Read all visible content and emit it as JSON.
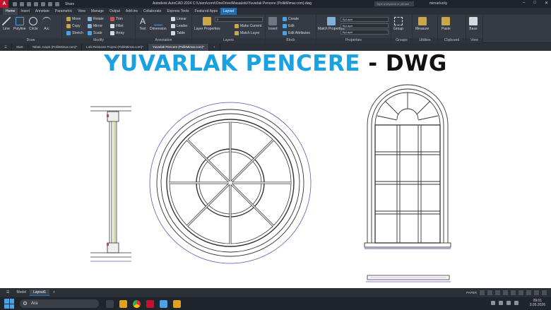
{
  "titlebar": {
    "title": "Autodesk AutoCAD 2024   C:\\Users\\corni\\OneDrive\\Masaüstü\\Yuvarlak Pencere (PolikMimar.com).dwg",
    "share": "Share",
    "search_placeholder": "Type a keyword or phrase",
    "user": "mimarlucity"
  },
  "ribbon_tabs": [
    "Home",
    "Insert",
    "Annotate",
    "Parametric",
    "View",
    "Manage",
    "Output",
    "Add-ins",
    "Collaborate",
    "Express Tools",
    "Featured Apps",
    "Layout"
  ],
  "ribbon": {
    "draw": {
      "title": "Draw",
      "tools": [
        "Line",
        "Polyline",
        "Circle",
        "Arc"
      ]
    },
    "modify": {
      "title": "Modify",
      "tools": [
        "Move",
        "Rotate",
        "Trim",
        "Copy",
        "Mirror",
        "Fillet",
        "Stretch",
        "Scale",
        "Array"
      ]
    },
    "annotation": {
      "title": "Annotation",
      "tools": [
        "Text",
        "Dimension",
        "Linear",
        "Leader",
        "Table"
      ]
    },
    "layers": {
      "title": "Layers",
      "tools": [
        "Layer Properties",
        "Make Current",
        "Match Layer"
      ],
      "layer_value": "0"
    },
    "block": {
      "title": "Block",
      "tools": [
        "Insert",
        "Create",
        "Edit",
        "Edit Attributes"
      ]
    },
    "properties": {
      "title": "Properties",
      "tools": [
        "Match Properties"
      ],
      "bylayer_1": "ByLayer",
      "bylayer_2": "ByLayer",
      "bylayer_3": "ByLayer"
    },
    "groups": {
      "title": "Groups",
      "tools": [
        "Group"
      ]
    },
    "utilities": {
      "title": "Utilities",
      "tools": [
        "Measure"
      ]
    },
    "clipboard": {
      "title": "Clipboard",
      "tools": [
        "Paste"
      ]
    },
    "view": {
      "title": "View",
      "tools": [
        "Base"
      ]
    }
  },
  "filetabs": [
    "Start",
    "Tabak, Kaşık (PolikMimar.com)*",
    "Lobi Restoran Projesi (PolikMimar.com)*",
    "Yuvarlak Pencere (PolikMimar.com)*"
  ],
  "canvas": {
    "headline_blue": "YUVARLAK PENCERE",
    "headline_sep": " - ",
    "headline_black": "DWG"
  },
  "layout_tabs": [
    "Model",
    "Layout1"
  ],
  "status": {
    "paper": "PAPER"
  },
  "taskbar": {
    "search_text": "Ara",
    "time": "09:01",
    "date": "3.05.2026"
  },
  "colors": {
    "accent_blue": "#1aa1e0",
    "autocad_red": "#c8102e",
    "layout_tab": "#1f6fb2"
  }
}
